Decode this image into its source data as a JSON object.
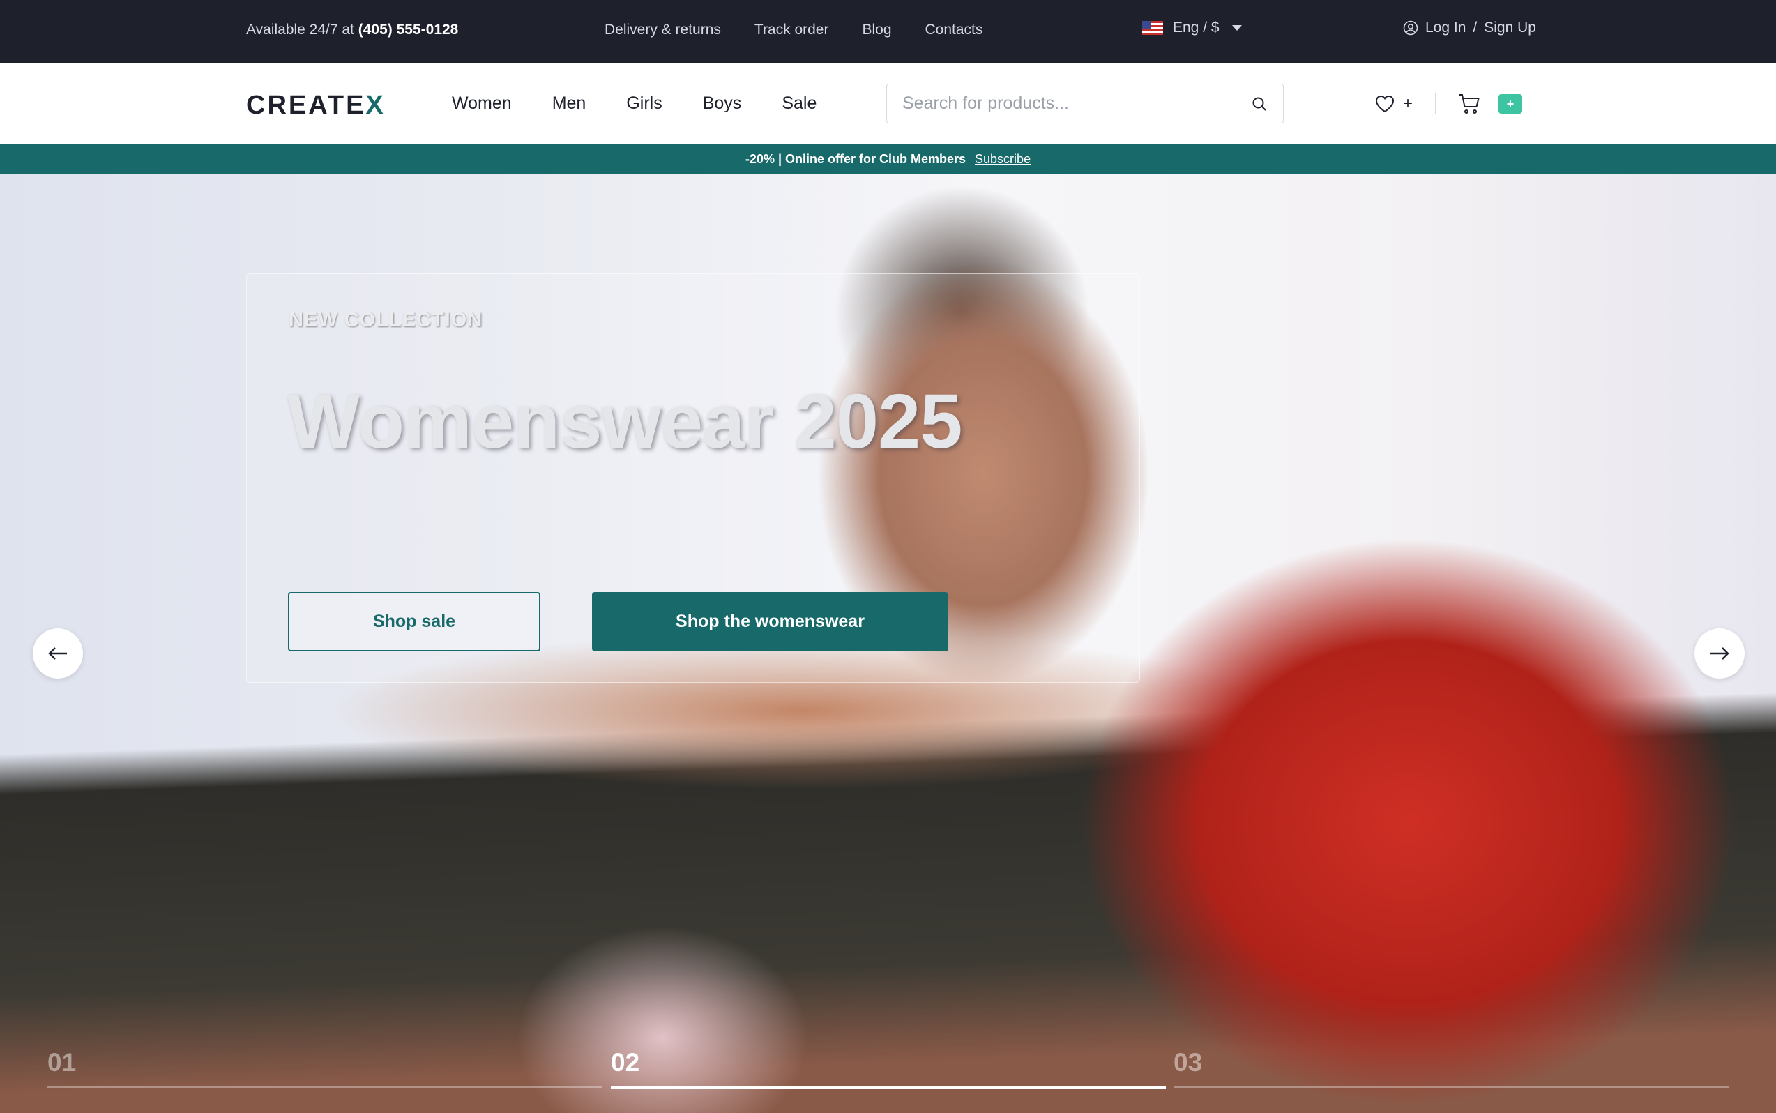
{
  "topbar": {
    "avail_prefix": "Available 24/7 at",
    "phone": "(405) 555-0128",
    "links": [
      "Delivery & returns",
      "Track order",
      "Blog",
      "Contacts"
    ],
    "lang": "Eng / $",
    "login": "Log In",
    "sep": "/",
    "signup": "Sign Up"
  },
  "header": {
    "logo": "CREATE",
    "logo_mark": "X",
    "nav": [
      "Women",
      "Men",
      "Girls",
      "Boys",
      "Sale"
    ],
    "search_placeholder": "Search for products...",
    "wishlist_count": "+",
    "cart_badge": "+"
  },
  "promo": {
    "text": "-20% | Online offer for Club Members",
    "link": "Subscribe"
  },
  "hero": {
    "eyebrow": "NEW COLLECTION",
    "title": "Womenswear 2025",
    "btn_outline": "Shop sale",
    "btn_solid": "Shop the womenswear",
    "slides": [
      "01",
      "02",
      "03"
    ],
    "active_slide": 2
  },
  "colors": {
    "brand": "#17696a",
    "dark": "#1e212c",
    "badge": "#3cc5a0"
  }
}
